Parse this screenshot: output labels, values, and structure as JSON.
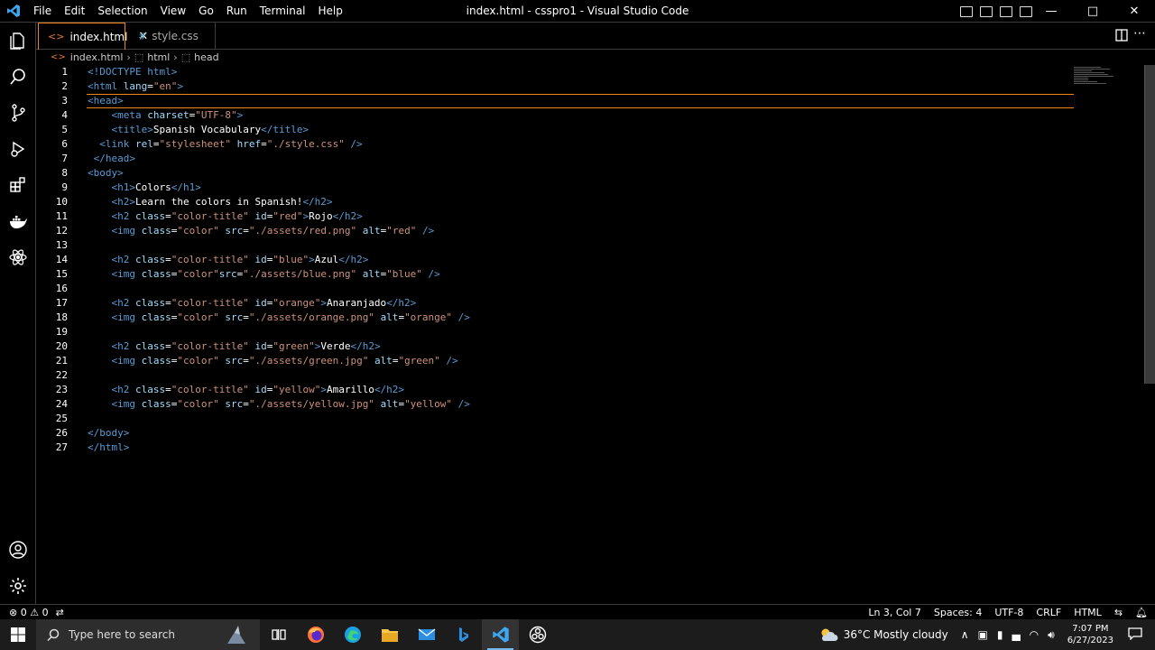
{
  "titlebar": {
    "menu": [
      "File",
      "Edit",
      "Selection",
      "View",
      "Go",
      "Run",
      "Terminal",
      "Help"
    ],
    "title": "index.html - csspro1 - Visual Studio Code"
  },
  "tabs": [
    {
      "label": "index.html",
      "icon": "<>",
      "active": true
    },
    {
      "label": "style.css",
      "icon": "#",
      "active": false
    }
  ],
  "breadcrumb": [
    "index.html",
    "html",
    "head"
  ],
  "editor": {
    "lines": [
      {
        "n": "1",
        "parts": [
          [
            "tag",
            "<!DOCTYPE html>"
          ]
        ]
      },
      {
        "n": "2",
        "parts": [
          [
            "tag",
            "<html "
          ],
          [
            "attr",
            "lang"
          ],
          [
            "txt",
            "="
          ],
          [
            "str",
            "\"en\""
          ],
          [
            "tag",
            ">"
          ]
        ]
      },
      {
        "n": "3",
        "parts": [
          [
            "tag",
            "<head>"
          ]
        ]
      },
      {
        "n": "4",
        "parts": [
          [
            "txt",
            "    "
          ],
          [
            "tag",
            "<meta "
          ],
          [
            "attr",
            "charset"
          ],
          [
            "txt",
            "="
          ],
          [
            "str",
            "\"UTF-8\""
          ],
          [
            "tag",
            ">"
          ]
        ]
      },
      {
        "n": "5",
        "parts": [
          [
            "txt",
            "    "
          ],
          [
            "tag",
            "<title>"
          ],
          [
            "txt",
            "Spanish Vocabulary"
          ],
          [
            "tag",
            "</title>"
          ]
        ]
      },
      {
        "n": "6",
        "parts": [
          [
            "txt",
            "  "
          ],
          [
            "tag",
            "<link "
          ],
          [
            "attr",
            "rel"
          ],
          [
            "txt",
            "="
          ],
          [
            "str",
            "\"stylesheet\" "
          ],
          [
            "attr",
            "href"
          ],
          [
            "txt",
            "="
          ],
          [
            "str",
            "\"./style.css\""
          ],
          [
            "tag",
            " />"
          ]
        ]
      },
      {
        "n": "7",
        "parts": [
          [
            "txt",
            " "
          ],
          [
            "tag",
            "</head>"
          ]
        ]
      },
      {
        "n": "8",
        "parts": [
          [
            "tag",
            "<body>"
          ]
        ]
      },
      {
        "n": "9",
        "parts": [
          [
            "txt",
            "    "
          ],
          [
            "tag",
            "<h1>"
          ],
          [
            "txt",
            "Colors"
          ],
          [
            "tag",
            "</h1>"
          ]
        ]
      },
      {
        "n": "10",
        "parts": [
          [
            "txt",
            "    "
          ],
          [
            "tag",
            "<h2>"
          ],
          [
            "txt",
            "Learn the colors in Spanish!"
          ],
          [
            "tag",
            "</h2>"
          ]
        ]
      },
      {
        "n": "11",
        "parts": [
          [
            "txt",
            "    "
          ],
          [
            "tag",
            "<h2 "
          ],
          [
            "attr",
            "class"
          ],
          [
            "txt",
            "="
          ],
          [
            "str",
            "\"color-title\" "
          ],
          [
            "attr",
            "id"
          ],
          [
            "txt",
            "="
          ],
          [
            "str",
            "\"red\""
          ],
          [
            "tag",
            ">"
          ],
          [
            "txt",
            "Rojo"
          ],
          [
            "tag",
            "</h2>"
          ]
        ]
      },
      {
        "n": "12",
        "parts": [
          [
            "txt",
            "    "
          ],
          [
            "tag",
            "<img "
          ],
          [
            "attr",
            "class"
          ],
          [
            "txt",
            "="
          ],
          [
            "str",
            "\"color\" "
          ],
          [
            "attr",
            "src"
          ],
          [
            "txt",
            "="
          ],
          [
            "str",
            "\"./assets/red.png\" "
          ],
          [
            "attr",
            "alt"
          ],
          [
            "txt",
            "="
          ],
          [
            "str",
            "\"red\""
          ],
          [
            "tag",
            " />"
          ]
        ]
      },
      {
        "n": "13",
        "parts": []
      },
      {
        "n": "14",
        "parts": [
          [
            "txt",
            "    "
          ],
          [
            "tag",
            "<h2 "
          ],
          [
            "attr",
            "class"
          ],
          [
            "txt",
            "="
          ],
          [
            "str",
            "\"color-title\" "
          ],
          [
            "attr",
            "id"
          ],
          [
            "txt",
            "="
          ],
          [
            "str",
            "\"blue\""
          ],
          [
            "tag",
            ">"
          ],
          [
            "txt",
            "Azul"
          ],
          [
            "tag",
            "</h2>"
          ]
        ]
      },
      {
        "n": "15",
        "parts": [
          [
            "txt",
            "    "
          ],
          [
            "tag",
            "<img "
          ],
          [
            "attr",
            "class"
          ],
          [
            "txt",
            "="
          ],
          [
            "str",
            "\"color\""
          ],
          [
            "attr",
            "src"
          ],
          [
            "txt",
            "="
          ],
          [
            "str",
            "\"./assets/blue.png\" "
          ],
          [
            "attr",
            "alt"
          ],
          [
            "txt",
            "="
          ],
          [
            "str",
            "\"blue\""
          ],
          [
            "tag",
            " />"
          ]
        ]
      },
      {
        "n": "16",
        "parts": []
      },
      {
        "n": "17",
        "parts": [
          [
            "txt",
            "    "
          ],
          [
            "tag",
            "<h2 "
          ],
          [
            "attr",
            "class"
          ],
          [
            "txt",
            "="
          ],
          [
            "str",
            "\"color-title\" "
          ],
          [
            "attr",
            "id"
          ],
          [
            "txt",
            "="
          ],
          [
            "str",
            "\"orange\""
          ],
          [
            "tag",
            ">"
          ],
          [
            "txt",
            "Anaranjado"
          ],
          [
            "tag",
            "</h2>"
          ]
        ]
      },
      {
        "n": "18",
        "parts": [
          [
            "txt",
            "    "
          ],
          [
            "tag",
            "<img "
          ],
          [
            "attr",
            "class"
          ],
          [
            "txt",
            "="
          ],
          [
            "str",
            "\"color\" "
          ],
          [
            "attr",
            "src"
          ],
          [
            "txt",
            "="
          ],
          [
            "str",
            "\"./assets/orange.png\" "
          ],
          [
            "attr",
            "alt"
          ],
          [
            "txt",
            "="
          ],
          [
            "str",
            "\"orange\""
          ],
          [
            "tag",
            " />"
          ]
        ]
      },
      {
        "n": "19",
        "parts": []
      },
      {
        "n": "20",
        "parts": [
          [
            "txt",
            "    "
          ],
          [
            "tag",
            "<h2 "
          ],
          [
            "attr",
            "class"
          ],
          [
            "txt",
            "="
          ],
          [
            "str",
            "\"color-title\" "
          ],
          [
            "attr",
            "id"
          ],
          [
            "txt",
            "="
          ],
          [
            "str",
            "\"green\""
          ],
          [
            "tag",
            ">"
          ],
          [
            "txt",
            "Verde"
          ],
          [
            "tag",
            "</h2>"
          ]
        ]
      },
      {
        "n": "21",
        "parts": [
          [
            "txt",
            "    "
          ],
          [
            "tag",
            "<img "
          ],
          [
            "attr",
            "class"
          ],
          [
            "txt",
            "="
          ],
          [
            "str",
            "\"color\" "
          ],
          [
            "attr",
            "src"
          ],
          [
            "txt",
            "="
          ],
          [
            "str",
            "\"./assets/green.jpg\" "
          ],
          [
            "attr",
            "alt"
          ],
          [
            "txt",
            "="
          ],
          [
            "str",
            "\"green\""
          ],
          [
            "tag",
            " />"
          ]
        ]
      },
      {
        "n": "22",
        "parts": []
      },
      {
        "n": "23",
        "parts": [
          [
            "txt",
            "    "
          ],
          [
            "tag",
            "<h2 "
          ],
          [
            "attr",
            "class"
          ],
          [
            "txt",
            "="
          ],
          [
            "str",
            "\"color-title\" "
          ],
          [
            "attr",
            "id"
          ],
          [
            "txt",
            "="
          ],
          [
            "str",
            "\"yellow\""
          ],
          [
            "tag",
            ">"
          ],
          [
            "txt",
            "Amarillo"
          ],
          [
            "tag",
            "</h2>"
          ]
        ]
      },
      {
        "n": "24",
        "parts": [
          [
            "txt",
            "    "
          ],
          [
            "tag",
            "<img "
          ],
          [
            "attr",
            "class"
          ],
          [
            "txt",
            "="
          ],
          [
            "str",
            "\"color\" "
          ],
          [
            "attr",
            "src"
          ],
          [
            "txt",
            "="
          ],
          [
            "str",
            "\"./assets/yellow.jpg\" "
          ],
          [
            "attr",
            "alt"
          ],
          [
            "txt",
            "="
          ],
          [
            "str",
            "\"yellow\""
          ],
          [
            "tag",
            " />"
          ]
        ]
      },
      {
        "n": "25",
        "parts": []
      },
      {
        "n": "26",
        "parts": [
          [
            "tag",
            "</body>"
          ]
        ]
      },
      {
        "n": "27",
        "parts": [
          [
            "tag",
            "</html>"
          ]
        ]
      }
    ]
  },
  "statusbar": {
    "errors": "0",
    "warnings": "0",
    "position": "Ln 3, Col 7",
    "spaces": "Spaces: 4",
    "encoding": "UTF-8",
    "eol": "CRLF",
    "language": "HTML"
  },
  "taskbar": {
    "search_placeholder": "Type here to search",
    "weather": "36°C  Mostly cloudy",
    "time": "7:07 PM",
    "date": "6/27/2023"
  },
  "colors": {
    "accent_border": "#f38518",
    "tag": "#569cd6",
    "attr": "#9cdcfe",
    "string": "#ce9178"
  }
}
